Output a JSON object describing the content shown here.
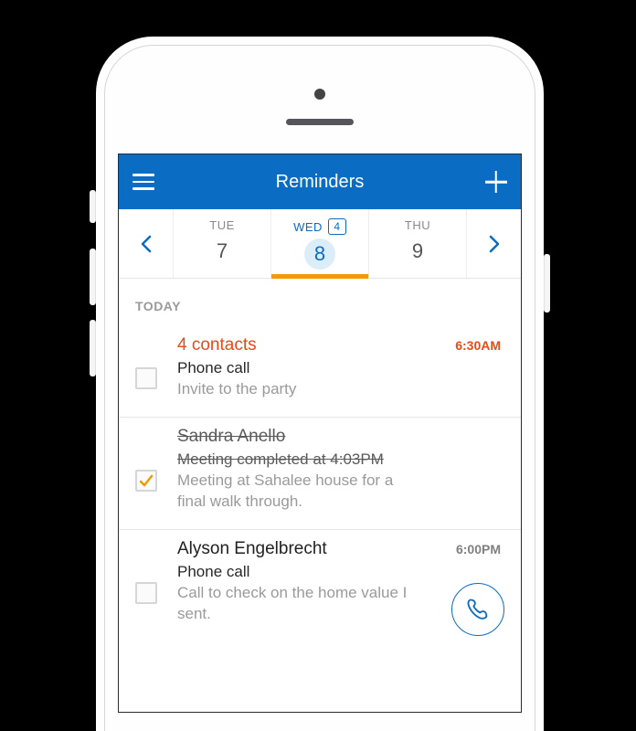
{
  "colors": {
    "brand": "#0a6cc3",
    "accent": "#f29a00",
    "overdue": "#e84a1c"
  },
  "topbar": {
    "title": "Reminders",
    "menu_icon": "hamburger-icon",
    "add_icon": "plus-icon"
  },
  "datestrip": {
    "prev_icon": "chevron-left-icon",
    "next_icon": "chevron-right-icon",
    "days": [
      {
        "label": "TUE",
        "num": "7",
        "selected": false,
        "badge": ""
      },
      {
        "label": "WED",
        "num": "8",
        "selected": true,
        "badge": "4"
      },
      {
        "label": "THU",
        "num": "9",
        "selected": false,
        "badge": ""
      }
    ]
  },
  "list": {
    "section": "TODAY",
    "items": [
      {
        "title": "4 contacts",
        "time": "6:30AM",
        "line1": "Phone call",
        "line2": "Invite to the party",
        "overdue": true,
        "completed": false,
        "show_call": false
      },
      {
        "title": "Sandra Anello",
        "time": "",
        "line1": "Meeting completed at 4:03PM",
        "line2": "Meeting at Sahalee house for a final walk through.",
        "overdue": false,
        "completed": true,
        "show_call": false
      },
      {
        "title": "Alyson Engelbrecht",
        "time": "6:00PM",
        "line1": "Phone call",
        "line2": "Call to check on the home value I sent.",
        "overdue": false,
        "completed": false,
        "show_call": true
      }
    ]
  }
}
